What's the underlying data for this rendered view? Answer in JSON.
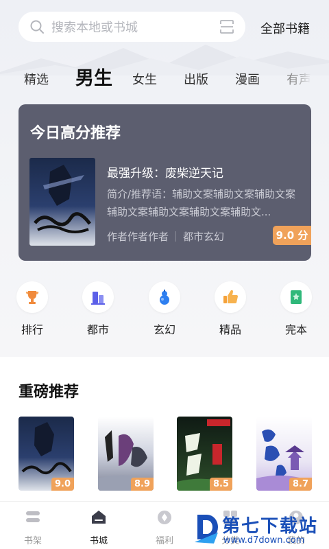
{
  "header": {
    "search_placeholder": "搜索本地或书城",
    "all_books": "全部书籍"
  },
  "tabs": [
    {
      "label": "精选"
    },
    {
      "label": "男生"
    },
    {
      "label": "女生"
    },
    {
      "label": "出版"
    },
    {
      "label": "漫画"
    },
    {
      "label": "有声"
    }
  ],
  "featured": {
    "section_title": "今日高分推荐",
    "book_name": "最强升级：废柴逆天记",
    "description": "简介/推荐语：辅助文案辅助文案辅助文案辅助文案辅助文案辅助文案辅助文...",
    "author": "作者作者作者",
    "genre": "都市玄幻",
    "score": "9.0 分"
  },
  "categories": [
    {
      "label": "排行",
      "icon": "trophy-icon"
    },
    {
      "label": "都市",
      "icon": "city-icon"
    },
    {
      "label": "玄幻",
      "icon": "gourd-icon"
    },
    {
      "label": "精品",
      "icon": "thumbs-up-icon"
    },
    {
      "label": "完本",
      "icon": "bookmark-icon"
    }
  ],
  "recommend": {
    "title": "重磅推荐",
    "books": [
      {
        "score": "9.0"
      },
      {
        "score": "8.9"
      },
      {
        "score": "8.5"
      },
      {
        "score": "8.7"
      }
    ]
  },
  "nav": [
    {
      "label": "书架",
      "icon": "bookshelf-icon"
    },
    {
      "label": "书城",
      "icon": "bookstore-icon"
    },
    {
      "label": "福利",
      "icon": "welfare-icon"
    },
    {
      "label": "分类",
      "icon": "category-icon"
    },
    {
      "label": "我的",
      "icon": "profile-icon"
    }
  ],
  "watermark": {
    "title": "第七下载站",
    "url": "www.d7down.com"
  },
  "colors": {
    "featured_bg": "#5c5e6f",
    "score_badge": "#f0a25a",
    "watermark": "#1a4fb8"
  }
}
